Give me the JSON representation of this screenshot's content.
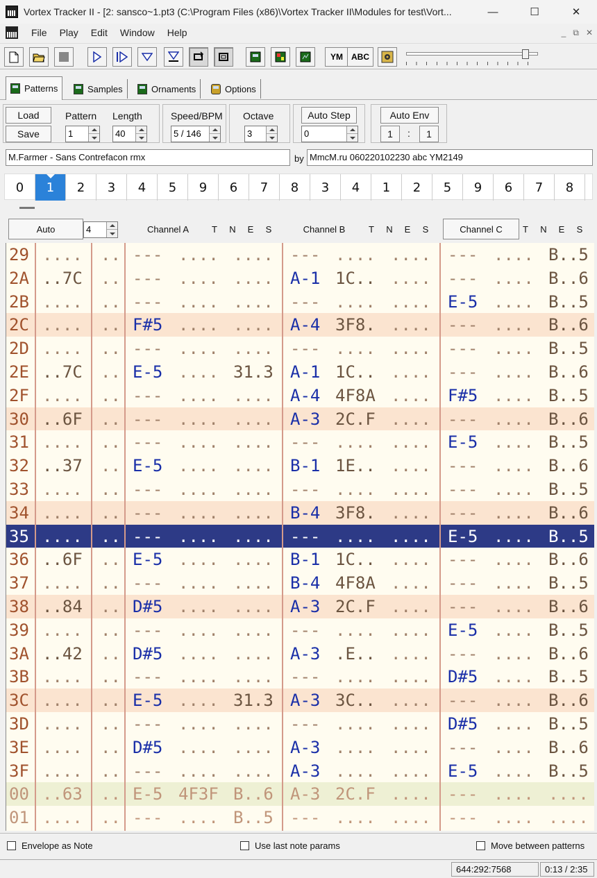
{
  "window": {
    "title": "Vortex Tracker II - [2: sansco~1.pt3 (C:\\Program Files (x86)\\Vortex Tracker II\\Modules for test\\Vort...",
    "minimize": "—",
    "maximize": "☐",
    "close": "✕"
  },
  "menu": {
    "items": [
      "File",
      "Play",
      "Edit",
      "Window",
      "Help"
    ],
    "mdi_minimize": "_",
    "mdi_restore": "⧉",
    "mdi_close": "✕"
  },
  "toolbar": {
    "ym_label": "YM",
    "abc_label": "ABC",
    "volume_level": 0.93
  },
  "tabs": [
    {
      "label": "Patterns",
      "icon": "patterns-icon"
    },
    {
      "label": "Samples",
      "icon": "samples-icon"
    },
    {
      "label": "Ornaments",
      "icon": "ornaments-icon"
    },
    {
      "label": "Options",
      "icon": "options-icon"
    }
  ],
  "controls": {
    "load": "Load",
    "save": "Save",
    "pattern_label": "Pattern",
    "pattern_value": "1",
    "length_label": "Length",
    "length_value": "40",
    "speed_label": "Speed/BPM",
    "speed_value": "5 / 146",
    "octave_label": "Octave",
    "octave_value": "3",
    "auto_step_label": "Auto Step",
    "auto_step_value": "0",
    "auto_env_label": "Auto Env",
    "auto_env_a": "1",
    "auto_env_sep": ":",
    "auto_env_b": "1"
  },
  "info": {
    "title_value": "M.Farmer - Sans Contrefacon rmx",
    "by_label": "by",
    "author_value": "MmcM.ru 060220102230 abc YM2149"
  },
  "positions": [
    "0",
    "1",
    "2",
    "3",
    "4",
    "5",
    "9",
    "6",
    "7",
    "8",
    "3",
    "4",
    "1",
    "2",
    "5",
    "9",
    "6",
    "7",
    "8"
  ],
  "current_position_index": 1,
  "channels": {
    "auto_label": "Auto",
    "auto_value": "4",
    "a": "Channel A",
    "b": "Channel B",
    "c": "Channel C",
    "flags": [
      "T",
      "N",
      "E",
      "S"
    ]
  },
  "pattern_rows": [
    {
      "n": "29",
      "s": "alt0",
      "env": "....",
      "noise": "..",
      "a": [
        "---",
        "....",
        "...."
      ],
      "b": [
        "---",
        "....",
        "...."
      ],
      "c": [
        "---",
        "....",
        "B..5"
      ]
    },
    {
      "n": "2A",
      "s": "",
      "env": "..7C",
      "noise": "..",
      "a": [
        "---",
        "....",
        "...."
      ],
      "b": [
        "A-1",
        "1C..",
        "...."
      ],
      "c": [
        "---",
        "....",
        "B..6"
      ]
    },
    {
      "n": "2B",
      "s": "",
      "env": "....",
      "noise": "..",
      "a": [
        "---",
        "....",
        "...."
      ],
      "b": [
        "---",
        "....",
        "...."
      ],
      "c": [
        "E-5",
        "....",
        "B..5"
      ]
    },
    {
      "n": "2C",
      "s": "alt",
      "env": "....",
      "noise": "..",
      "a": [
        "F#5",
        "....",
        "...."
      ],
      "b": [
        "A-4",
        "3F8.",
        "...."
      ],
      "c": [
        "---",
        "....",
        "B..6"
      ]
    },
    {
      "n": "2D",
      "s": "",
      "env": "....",
      "noise": "..",
      "a": [
        "---",
        "....",
        "...."
      ],
      "b": [
        "---",
        "....",
        "...."
      ],
      "c": [
        "---",
        "....",
        "B..5"
      ]
    },
    {
      "n": "2E",
      "s": "",
      "env": "..7C",
      "noise": "..",
      "a": [
        "E-5",
        "....",
        "31.3"
      ],
      "b": [
        "A-1",
        "1C..",
        "...."
      ],
      "c": [
        "---",
        "....",
        "B..6"
      ]
    },
    {
      "n": "2F",
      "s": "",
      "env": "....",
      "noise": "..",
      "a": [
        "---",
        "....",
        "...."
      ],
      "b": [
        "A-4",
        "4F8A",
        "...."
      ],
      "c": [
        "F#5",
        "....",
        "B..5"
      ]
    },
    {
      "n": "30",
      "s": "alt",
      "env": "..6F",
      "noise": "..",
      "a": [
        "---",
        "....",
        "...."
      ],
      "b": [
        "A-3",
        "2C.F",
        "...."
      ],
      "c": [
        "---",
        "....",
        "B..6"
      ]
    },
    {
      "n": "31",
      "s": "",
      "env": "....",
      "noise": "..",
      "a": [
        "---",
        "....",
        "...."
      ],
      "b": [
        "---",
        "....",
        "...."
      ],
      "c": [
        "E-5",
        "....",
        "B..5"
      ]
    },
    {
      "n": "32",
      "s": "",
      "env": "..37",
      "noise": "..",
      "a": [
        "E-5",
        "....",
        "...."
      ],
      "b": [
        "B-1",
        "1E..",
        "...."
      ],
      "c": [
        "---",
        "....",
        "B..6"
      ]
    },
    {
      "n": "33",
      "s": "",
      "env": "....",
      "noise": "..",
      "a": [
        "---",
        "....",
        "...."
      ],
      "b": [
        "---",
        "....",
        "...."
      ],
      "c": [
        "---",
        "....",
        "B..5"
      ]
    },
    {
      "n": "34",
      "s": "alt",
      "env": "....",
      "noise": "..",
      "a": [
        "---",
        "....",
        "...."
      ],
      "b": [
        "B-4",
        "3F8.",
        "...."
      ],
      "c": [
        "---",
        "....",
        "B..6"
      ]
    },
    {
      "n": "35",
      "s": "sel",
      "env": "....",
      "noise": "..",
      "a": [
        "---",
        "....",
        "...."
      ],
      "b": [
        "---",
        "....",
        "...."
      ],
      "c": [
        "E-5",
        "....",
        "B..5"
      ]
    },
    {
      "n": "36",
      "s": "",
      "env": "..6F",
      "noise": "..",
      "a": [
        "E-5",
        "....",
        "...."
      ],
      "b": [
        "B-1",
        "1C..",
        "...."
      ],
      "c": [
        "---",
        "....",
        "B..6"
      ]
    },
    {
      "n": "37",
      "s": "",
      "env": "....",
      "noise": "..",
      "a": [
        "---",
        "....",
        "...."
      ],
      "b": [
        "B-4",
        "4F8A",
        "...."
      ],
      "c": [
        "---",
        "....",
        "B..5"
      ]
    },
    {
      "n": "38",
      "s": "alt",
      "env": "..84",
      "noise": "..",
      "a": [
        "D#5",
        "....",
        "...."
      ],
      "b": [
        "A-3",
        "2C.F",
        "...."
      ],
      "c": [
        "---",
        "....",
        "B..6"
      ]
    },
    {
      "n": "39",
      "s": "",
      "env": "....",
      "noise": "..",
      "a": [
        "---",
        "....",
        "...."
      ],
      "b": [
        "---",
        "....",
        "...."
      ],
      "c": [
        "E-5",
        "....",
        "B..5"
      ]
    },
    {
      "n": "3A",
      "s": "",
      "env": "..42",
      "noise": "..",
      "a": [
        "D#5",
        "....",
        "...."
      ],
      "b": [
        "A-3",
        ".E..",
        "...."
      ],
      "c": [
        "---",
        "....",
        "B..6"
      ]
    },
    {
      "n": "3B",
      "s": "",
      "env": "....",
      "noise": "..",
      "a": [
        "---",
        "....",
        "...."
      ],
      "b": [
        "---",
        "....",
        "...."
      ],
      "c": [
        "D#5",
        "....",
        "B..5"
      ]
    },
    {
      "n": "3C",
      "s": "alt",
      "env": "....",
      "noise": "..",
      "a": [
        "E-5",
        "....",
        "31.3"
      ],
      "b": [
        "A-3",
        "3C..",
        "...."
      ],
      "c": [
        "---",
        "....",
        "B..6"
      ]
    },
    {
      "n": "3D",
      "s": "",
      "env": "....",
      "noise": "..",
      "a": [
        "---",
        "....",
        "...."
      ],
      "b": [
        "---",
        "....",
        "...."
      ],
      "c": [
        "D#5",
        "....",
        "B..5"
      ]
    },
    {
      "n": "3E",
      "s": "",
      "env": "....",
      "noise": "..",
      "a": [
        "D#5",
        "....",
        "...."
      ],
      "b": [
        "A-3",
        "....",
        "...."
      ],
      "c": [
        "---",
        "....",
        "B..6"
      ]
    },
    {
      "n": "3F",
      "s": "",
      "env": "....",
      "noise": "..",
      "a": [
        "---",
        "....",
        "...."
      ],
      "b": [
        "A-3",
        "....",
        "...."
      ],
      "c": [
        "E-5",
        "....",
        "B..5"
      ]
    },
    {
      "n": "00",
      "s": "green",
      "env": "..63",
      "noise": "..",
      "a": [
        "E-5",
        "4F3F",
        "B..6"
      ],
      "b": [
        "A-3",
        "2C.F",
        "...."
      ],
      "c": [
        "---",
        "....",
        "...."
      ]
    },
    {
      "n": "01",
      "s": "green2",
      "env": "....",
      "noise": "..",
      "a": [
        "---",
        "....",
        "B..5"
      ],
      "b": [
        "---",
        "....",
        "...."
      ],
      "c": [
        "---",
        "....",
        "...."
      ]
    }
  ],
  "options": {
    "envelope_as_note": "Envelope as Note",
    "use_last_note_params": "Use last note params",
    "move_between_patterns": "Move between patterns"
  },
  "status": {
    "position": "644:292:7568",
    "time": "0:13 / 2:35"
  }
}
